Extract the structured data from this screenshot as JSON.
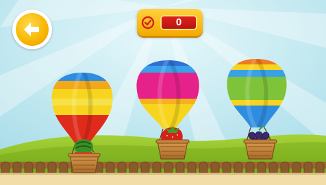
{
  "game": {
    "score_value": "0",
    "colors": {
      "sky": "#bfe9f3",
      "grass": "#89bf1f",
      "fence": "#8a5a2b",
      "path": "#f2dca8",
      "score_panel": "#f7b500",
      "score_box": "#d81f1b"
    }
  },
  "back_button": {
    "icon": "back-arrow-icon"
  },
  "score": {
    "icon": "check-circle-icon",
    "value": "0"
  },
  "balloons": [
    {
      "name": "balloon-watermelon",
      "fruit": "watermelon",
      "stripes": [
        "#2f8de0",
        "#f7d51e",
        "#e02a1c"
      ]
    },
    {
      "name": "balloon-strawberry",
      "fruit": "strawberry",
      "stripes": [
        "#2f6fd6",
        "#e6218a",
        "#f7d51e"
      ]
    },
    {
      "name": "balloon-grapes",
      "fruit": "grapes",
      "stripes": [
        "#f07a1d",
        "#7fc33b",
        "#2f8de0"
      ]
    }
  ]
}
